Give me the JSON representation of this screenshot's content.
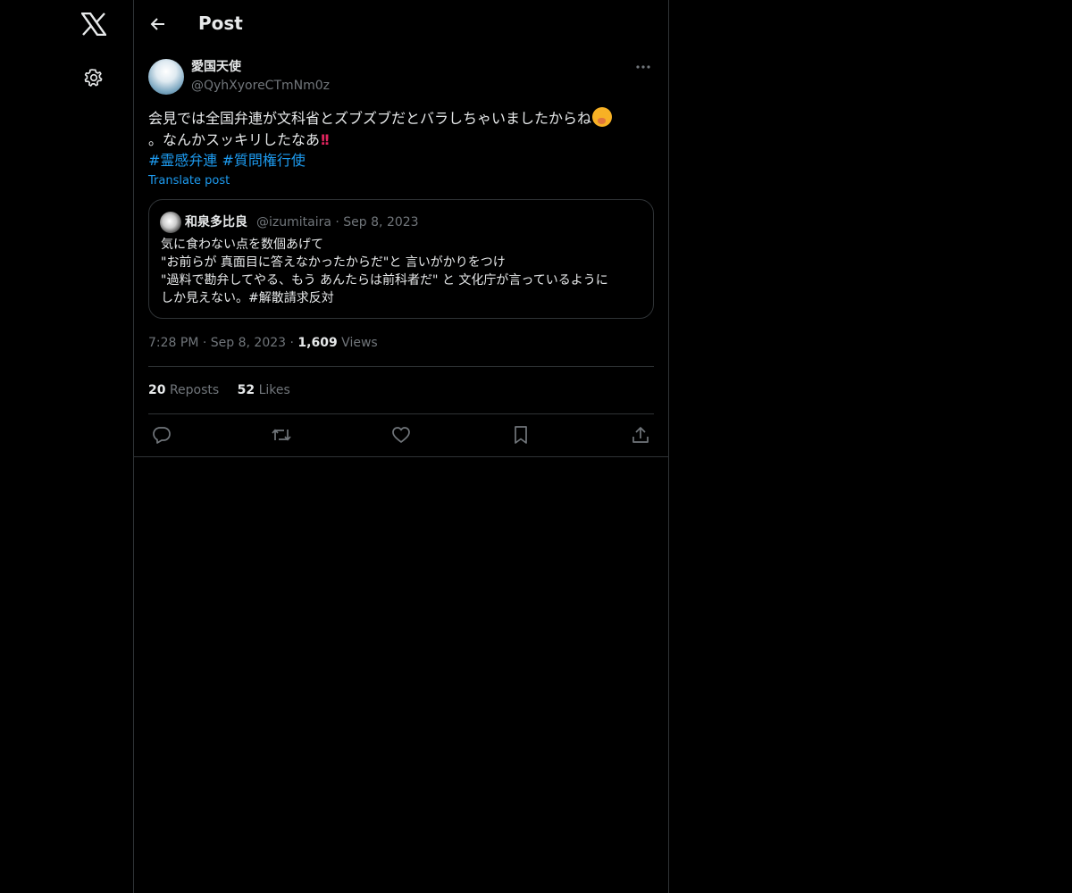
{
  "header": {
    "title": "Post"
  },
  "post": {
    "author_name": "愛国天使",
    "author_handle": "@QyhXyoreCTmNm0z",
    "text_line1": "会見では全国弁連が文科省とズブズブだとバラしちゃいましたからね",
    "text_line2": "。なんかスッキリしたなあ",
    "bangs": "!!",
    "hashtags": [
      "#霊感弁連",
      "#質問権行使"
    ],
    "translate_label": "Translate post",
    "time": "7:28 PM",
    "date": "Sep 8, 2023",
    "views_count": "1,609",
    "views_label": "Views",
    "reposts_count": "20",
    "reposts_label": "Reposts",
    "likes_count": "52",
    "likes_label": "Likes"
  },
  "quote": {
    "author_name": "和泉多比良",
    "author_handle": "@izumitaira",
    "date": "Sep 8, 2023",
    "lines": [
      "気に食わない点を数個あげて",
      "\"お前らが 真面目に答えなかったからだ\"と 言いがかりをつけ",
      "\"過料で勘弁してやる、もう あんたらは前科者だ\" と 文化庁が言っているように",
      "しか見えない。#解散請求反対"
    ]
  },
  "colors": {
    "background": "#000000",
    "text": "#e7e9ea",
    "muted": "#71767b",
    "accent": "#1d9bf0",
    "border": "#2f3336"
  },
  "icons": [
    "x-logo-icon",
    "gear-icon",
    "back-arrow-icon",
    "more-icon",
    "reply-icon",
    "repost-icon",
    "like-icon",
    "bookmark-icon",
    "share-icon"
  ]
}
